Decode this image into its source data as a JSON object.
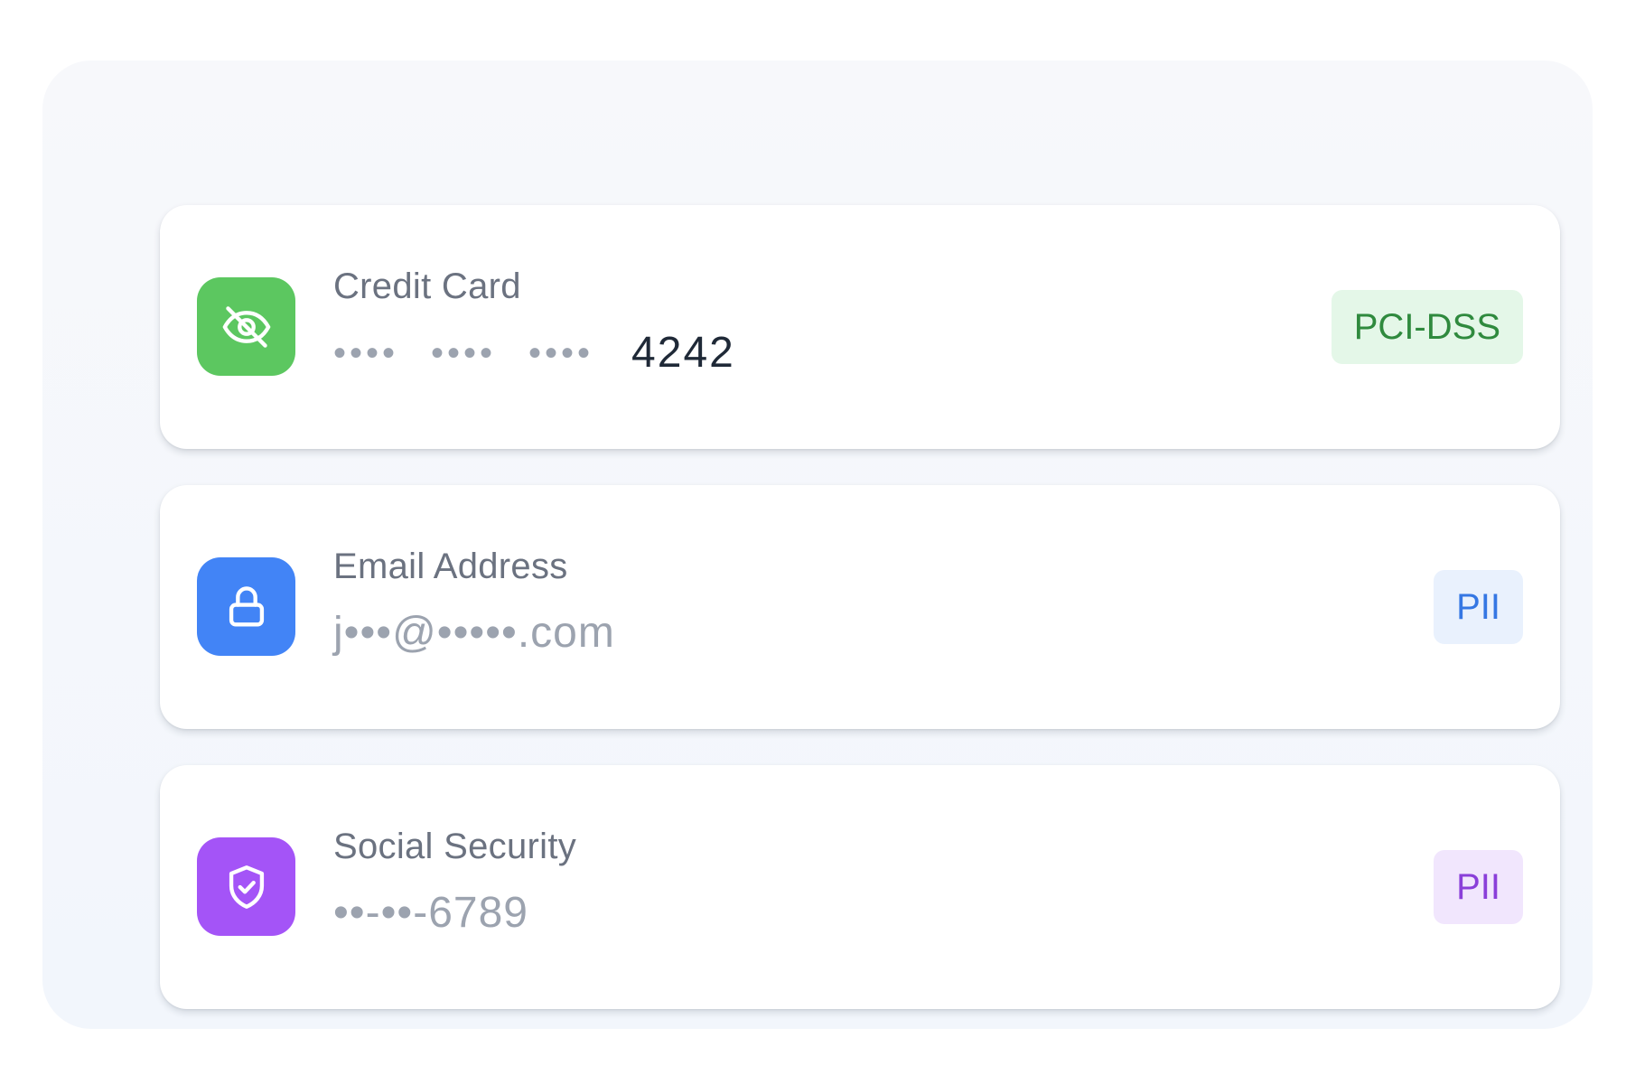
{
  "colors": {
    "credit_icon_bg": "#5cc760",
    "email_icon_bg": "#4284f6",
    "ssn_icon_bg": "#a454f7",
    "pci_badge_bg": "#e4f7e8",
    "pci_badge_text": "#2f8a3e",
    "pii_blue_bg": "#e9f1fd",
    "pii_blue_text": "#3577e3",
    "pii_purple_bg": "#f1e6fd",
    "pii_purple_text": "#8a3fd9"
  },
  "fields": [
    {
      "label": "Credit Card",
      "icon": "eye-off-icon",
      "masked_groups": [
        "••••",
        "••••",
        "••••"
      ],
      "last_four": "4242",
      "badge": "PCI-DSS"
    },
    {
      "label": "Email Address",
      "icon": "lock-icon",
      "value": "j•••@•••••.com",
      "badge": "PII"
    },
    {
      "label": "Social Security",
      "icon": "shield-check-icon",
      "value": "••-••-6789",
      "badge": "PII"
    }
  ]
}
